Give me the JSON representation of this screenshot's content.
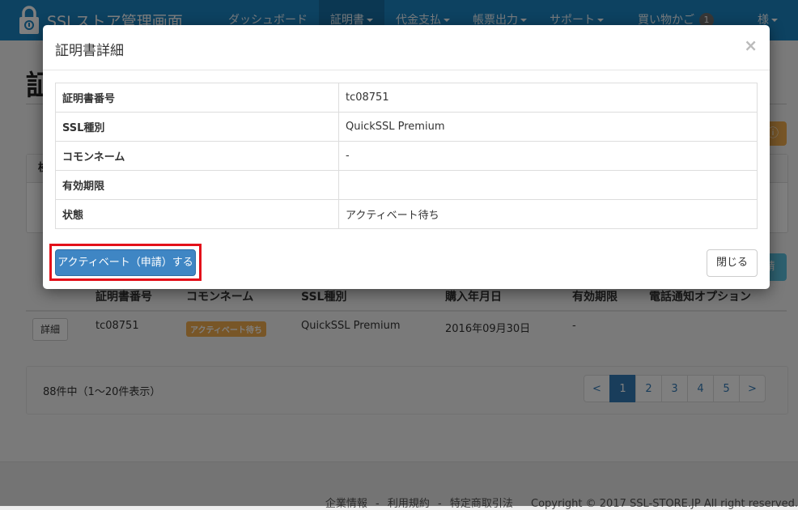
{
  "navbar": {
    "brand": "SSLストア管理画面",
    "items": [
      {
        "label": "ダッシュボード",
        "dropdown": false
      },
      {
        "label": "証明書",
        "dropdown": true
      },
      {
        "label": "代金支払",
        "dropdown": true
      },
      {
        "label": "帳票出力",
        "dropdown": true
      },
      {
        "label": "サポート",
        "dropdown": true
      }
    ],
    "cart_label": "買い物かご",
    "cart_count": "1",
    "user_suffix": "様"
  },
  "page": {
    "title": "証",
    "filter_panel_head": "検",
    "orange_button_glyph": "ⓘ",
    "cyan_button_label": "請",
    "list": {
      "headers": [
        "証明書番号",
        "コモンネーム",
        "SSL種別",
        "購入年月日",
        "有効期限",
        "電話通知オプション"
      ],
      "row": {
        "detail_button": "詳細",
        "number": "tc08751",
        "status": "アクティベート待ち",
        "ssl_type": "QuickSSL Premium",
        "purchase_date": "2016年09月30日",
        "expiry": "-"
      }
    },
    "pager": {
      "count_text": "88件中（1〜20件表示）",
      "prev": "<",
      "pages": [
        "1",
        "2",
        "3",
        "4",
        "5"
      ],
      "next": ">",
      "active_page": "1"
    },
    "footer": {
      "links": [
        "企業情報",
        "利用規約",
        "特定商取引法"
      ],
      "separator": "-",
      "copyright": "Copyright © 2017 SSL-STORE.JP All right reserved."
    }
  },
  "modal": {
    "title": "証明書詳細",
    "close_glyph": "×",
    "rows": [
      {
        "key": "証明書番号",
        "value": "tc08751"
      },
      {
        "key": "SSL種別",
        "value": "QuickSSL Premium"
      },
      {
        "key": "コモンネーム",
        "value": "-"
      },
      {
        "key": "有効期限",
        "value": ""
      },
      {
        "key": "状態",
        "value": "アクティベート待ち"
      }
    ],
    "activate_button": "アクティベート（申請）する",
    "close_button": "閉じる"
  },
  "colors": {
    "navbar": "#1b84c3",
    "primary": "#3f86c4",
    "warning": "#f0ad4e",
    "info": "#5bc0de",
    "highlight": "#e3101a"
  }
}
